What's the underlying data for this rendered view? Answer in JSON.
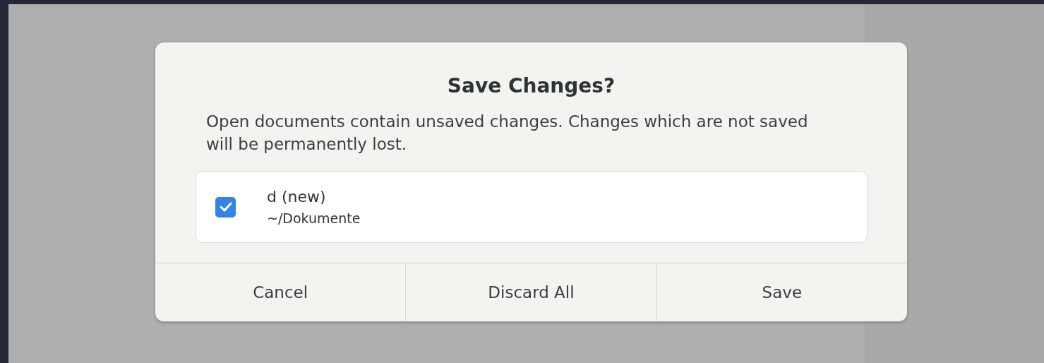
{
  "dialog": {
    "title": "Save Changes?",
    "message": "Open documents contain unsaved changes. Changes which are not saved will be permanently lost.",
    "documents": [
      {
        "name": "d (new)",
        "path": "~/Dokumente",
        "checked": true
      }
    ],
    "buttons": [
      {
        "label": "Cancel"
      },
      {
        "label": "Discard All"
      },
      {
        "label": "Save"
      }
    ]
  }
}
